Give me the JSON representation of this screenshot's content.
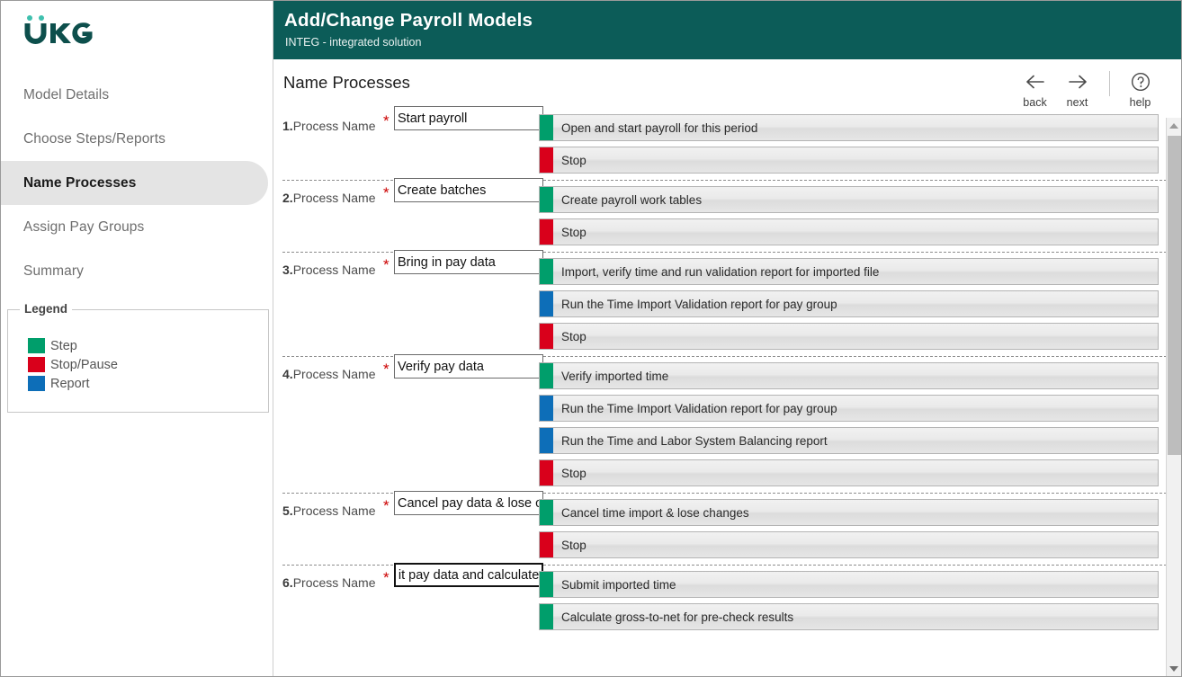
{
  "brand": {
    "logo_text": "UKG",
    "logo_dot_color": "#3fc0ae",
    "logo_color": "#0d4f4c"
  },
  "header": {
    "title": "Add/Change Payroll Models",
    "subtitle": "INTEG - integrated solution",
    "background_color": "#0c5c58"
  },
  "sidebar": {
    "items": [
      {
        "label": "Model Details",
        "active": false
      },
      {
        "label": "Choose Steps/Reports",
        "active": false
      },
      {
        "label": "Name Processes",
        "active": true
      },
      {
        "label": "Assign Pay Groups",
        "active": false
      },
      {
        "label": "Summary",
        "active": false
      }
    ],
    "legend": {
      "title": "Legend",
      "items": [
        {
          "label": "Step",
          "color": "#009e6b"
        },
        {
          "label": "Stop/Pause",
          "color": "#d9001b"
        },
        {
          "label": "Report",
          "color": "#0d6eb8"
        }
      ]
    }
  },
  "main": {
    "page_title": "Name Processes",
    "topnav": [
      {
        "label": "back",
        "icon": "arrow-left-icon"
      },
      {
        "label": "next",
        "icon": "arrow-right-icon"
      },
      {
        "label": "help",
        "icon": "help-circle-icon"
      }
    ],
    "process_label": "Process Name",
    "required_marker": "*",
    "processes": [
      {
        "number": "1.",
        "name_value": "Start payroll",
        "focused": false,
        "steps": [
          {
            "text": "Open and start payroll for this period",
            "type": "Step",
            "color": "#009e6b"
          },
          {
            "text": "Stop",
            "type": "Stop/Pause",
            "color": "#d9001b"
          }
        ]
      },
      {
        "number": "2.",
        "name_value": "Create batches",
        "focused": false,
        "steps": [
          {
            "text": "Create payroll work tables",
            "type": "Step",
            "color": "#009e6b"
          },
          {
            "text": "Stop",
            "type": "Stop/Pause",
            "color": "#d9001b"
          }
        ]
      },
      {
        "number": "3.",
        "name_value": "Bring in pay data",
        "focused": false,
        "steps": [
          {
            "text": "Import, verify time and run validation report for imported file",
            "type": "Step",
            "color": "#009e6b"
          },
          {
            "text": "Run the Time Import Validation report for pay group",
            "type": "Report",
            "color": "#0d6eb8"
          },
          {
            "text": "Stop",
            "type": "Stop/Pause",
            "color": "#d9001b"
          }
        ]
      },
      {
        "number": "4.",
        "name_value": "Verify pay data",
        "focused": false,
        "steps": [
          {
            "text": "Verify imported time",
            "type": "Step",
            "color": "#009e6b"
          },
          {
            "text": "Run the Time Import Validation report for pay group",
            "type": "Report",
            "color": "#0d6eb8"
          },
          {
            "text": "Run the Time and Labor System Balancing report",
            "type": "Report",
            "color": "#0d6eb8"
          },
          {
            "text": "Stop",
            "type": "Stop/Pause",
            "color": "#d9001b"
          }
        ]
      },
      {
        "number": "5.",
        "name_value": "Cancel pay data & lose changes",
        "focused": false,
        "steps": [
          {
            "text": "Cancel time import & lose changes",
            "type": "Step",
            "color": "#009e6b"
          },
          {
            "text": "Stop",
            "type": "Stop/Pause",
            "color": "#d9001b"
          }
        ]
      },
      {
        "number": "6.",
        "name_value": "Submit pay data and calculate",
        "focused": true,
        "steps": [
          {
            "text": "Submit imported time",
            "type": "Step",
            "color": "#009e6b"
          },
          {
            "text": "Calculate gross-to-net for pre-check results",
            "type": "Step",
            "color": "#009e6b"
          }
        ]
      }
    ]
  }
}
